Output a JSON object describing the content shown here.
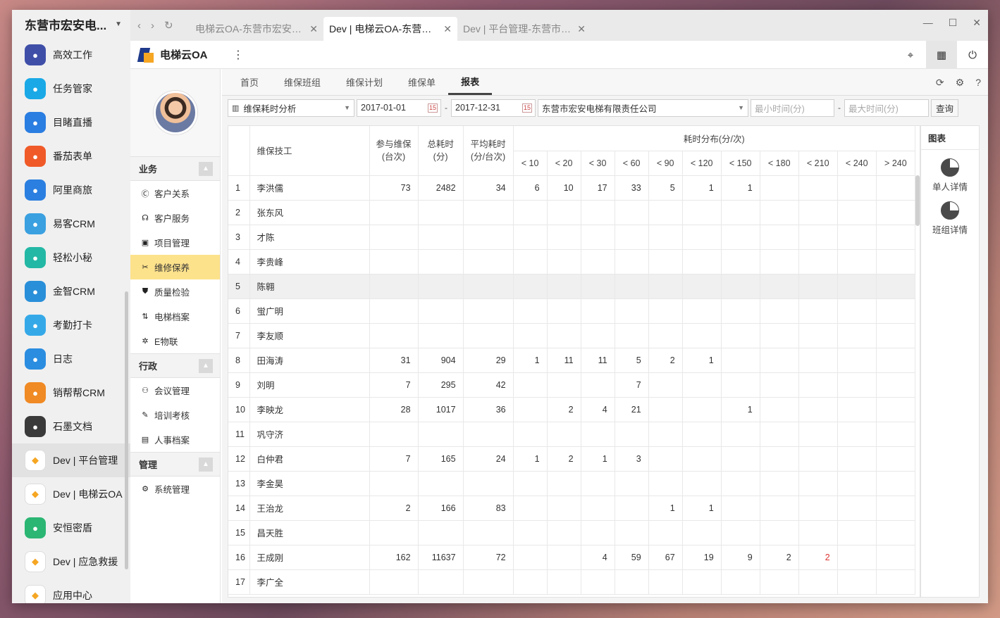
{
  "dock": {
    "title": "东营市宏安电...",
    "items": [
      {
        "label": "高效工作",
        "icon": "star-badge-icon",
        "color": "#3f4fa8"
      },
      {
        "label": "任务管家",
        "icon": "task-icon",
        "color": "#1aa9e6"
      },
      {
        "label": "目睹直播",
        "icon": "play-icon",
        "color": "#2a7de1"
      },
      {
        "label": "番茄表单",
        "icon": "tomato-icon",
        "color": "#f05a28"
      },
      {
        "label": "阿里商旅",
        "icon": "travel-icon",
        "color": "#2b7fe0"
      },
      {
        "label": "易客CRM",
        "icon": "crm-icon",
        "color": "#3aa0e0"
      },
      {
        "label": "轻松小秘",
        "icon": "note-icon",
        "color": "#23b8a5"
      },
      {
        "label": "金智CRM",
        "icon": "chart-icon",
        "color": "#2a8fd9"
      },
      {
        "label": "考勤打卡",
        "icon": "location-icon",
        "color": "#35a9e8"
      },
      {
        "label": "日志",
        "icon": "log-icon",
        "color": "#2b8de0"
      },
      {
        "label": "销帮帮CRM",
        "icon": "b-icon",
        "color": "#f08a24"
      },
      {
        "label": "石墨文档",
        "icon": "shimo-icon",
        "color": "#3a3a3a",
        "selected": true
      },
      {
        "label": "Dev | 平台管理",
        "icon": "platform-logo-icon",
        "color": "#ffffff",
        "selected": true
      },
      {
        "label": "Dev | 电梯云OA",
        "icon": "elevator-logo-icon",
        "color": "#ffffff"
      },
      {
        "label": "安恒密盾",
        "icon": "lock-icon",
        "color": "#2bb673"
      },
      {
        "label": "Dev | 应急救援",
        "icon": "24-icon",
        "color": "#ffffff"
      },
      {
        "label": "应用中心",
        "icon": "app-center-icon",
        "color": "#ffffff"
      }
    ]
  },
  "browser": {
    "tabs": [
      {
        "label": "电梯云OA-东营市宏安电...",
        "active": false
      },
      {
        "label": "Dev | 电梯云OA-东营市...",
        "active": true
      },
      {
        "label": "Dev | 平台管理-东营市宏...",
        "active": false
      }
    ]
  },
  "app": {
    "name": "电梯云OA"
  },
  "sidenav": {
    "sections": [
      {
        "title": "业务",
        "items": [
          {
            "label": "客户关系",
            "icon": "crm-icon"
          },
          {
            "label": "客户服务",
            "icon": "headset-icon"
          },
          {
            "label": "项目管理",
            "icon": "project-icon"
          },
          {
            "label": "维修保养",
            "icon": "tools-icon",
            "active": true
          },
          {
            "label": "质量检验",
            "icon": "shield-icon"
          },
          {
            "label": "电梯档案",
            "icon": "elevator-icon"
          },
          {
            "label": "E物联",
            "icon": "iot-icon"
          }
        ]
      },
      {
        "title": "行政",
        "items": [
          {
            "label": "会议管理",
            "icon": "meeting-icon"
          },
          {
            "label": "培训考核",
            "icon": "training-icon"
          },
          {
            "label": "人事档案",
            "icon": "hr-icon"
          }
        ]
      },
      {
        "title": "管理",
        "items": [
          {
            "label": "系统管理",
            "icon": "gears-icon"
          }
        ]
      }
    ]
  },
  "content_tabs": [
    "首页",
    "维保班组",
    "维保计划",
    "维保单",
    "报表"
  ],
  "filter": {
    "report_type": "维保耗时分析",
    "date_from": "2017-01-01",
    "date_to": "2017-12-31",
    "company": "东营市宏安电梯有限责任公司",
    "min_placeholder": "最小时间(分)",
    "max_placeholder": "最大时间(分)",
    "query_label": "查询"
  },
  "table": {
    "headers": {
      "tech": "维保技工",
      "count": "参与维保\n(台次)",
      "total": "总耗时\n(分)",
      "avg": "平均耗时\n(分/台次)",
      "dist": "耗时分布(分/次)"
    },
    "buckets": [
      "< 10",
      "< 20",
      "< 30",
      "< 60",
      "< 90",
      "< 120",
      "< 150",
      "< 180",
      "< 210",
      "< 240",
      "> 240"
    ],
    "rows": [
      {
        "idx": "1",
        "name": "李洪儒",
        "count": "73",
        "total": "2482",
        "avg": "34",
        "d": [
          "6",
          "10",
          "17",
          "33",
          "5",
          "1",
          "1",
          "",
          "",
          "",
          ""
        ]
      },
      {
        "idx": "2",
        "name": "张东风",
        "count": "",
        "total": "",
        "avg": "",
        "d": [
          "",
          "",
          "",
          "",
          "",
          "",
          "",
          "",
          "",
          "",
          ""
        ]
      },
      {
        "idx": "3",
        "name": "才陈",
        "count": "",
        "total": "",
        "avg": "",
        "d": [
          "",
          "",
          "",
          "",
          "",
          "",
          "",
          "",
          "",
          "",
          ""
        ]
      },
      {
        "idx": "4",
        "name": "李贵峰",
        "count": "",
        "total": "",
        "avg": "",
        "d": [
          "",
          "",
          "",
          "",
          "",
          "",
          "",
          "",
          "",
          "",
          ""
        ]
      },
      {
        "idx": "5",
        "name": "陈翱",
        "count": "",
        "total": "",
        "avg": "",
        "d": [
          "",
          "",
          "",
          "",
          "",
          "",
          "",
          "",
          "",
          "",
          ""
        ],
        "hl": true
      },
      {
        "idx": "6",
        "name": "蛍广明",
        "count": "",
        "total": "",
        "avg": "",
        "d": [
          "",
          "",
          "",
          "",
          "",
          "",
          "",
          "",
          "",
          "",
          ""
        ]
      },
      {
        "idx": "7",
        "name": "李友顺",
        "count": "",
        "total": "",
        "avg": "",
        "d": [
          "",
          "",
          "",
          "",
          "",
          "",
          "",
          "",
          "",
          "",
          ""
        ]
      },
      {
        "idx": "8",
        "name": "田海涛",
        "count": "31",
        "total": "904",
        "avg": "29",
        "d": [
          "1",
          "11",
          "11",
          "5",
          "2",
          "1",
          "",
          "",
          "",
          "",
          ""
        ]
      },
      {
        "idx": "9",
        "name": "刘明",
        "count": "7",
        "total": "295",
        "avg": "42",
        "d": [
          "",
          "",
          "",
          "7",
          "",
          "",
          "",
          "",
          "",
          "",
          ""
        ]
      },
      {
        "idx": "10",
        "name": "李映龙",
        "count": "28",
        "total": "1017",
        "avg": "36",
        "d": [
          "",
          "2",
          "4",
          "21",
          "",
          "",
          "1",
          "",
          "",
          "",
          ""
        ]
      },
      {
        "idx": "11",
        "name": "巩守济",
        "count": "",
        "total": "",
        "avg": "",
        "d": [
          "",
          "",
          "",
          "",
          "",
          "",
          "",
          "",
          "",
          "",
          ""
        ]
      },
      {
        "idx": "12",
        "name": "白仲君",
        "count": "7",
        "total": "165",
        "avg": "24",
        "d": [
          "1",
          "2",
          "1",
          "3",
          "",
          "",
          "",
          "",
          "",
          "",
          ""
        ]
      },
      {
        "idx": "13",
        "name": "李金昊",
        "count": "",
        "total": "",
        "avg": "",
        "d": [
          "",
          "",
          "",
          "",
          "",
          "",
          "",
          "",
          "",
          "",
          ""
        ]
      },
      {
        "idx": "14",
        "name": "王治龙",
        "count": "2",
        "total": "166",
        "avg": "83",
        "d": [
          "",
          "",
          "",
          "",
          "1",
          "1",
          "",
          "",
          "",
          "",
          ""
        ]
      },
      {
        "idx": "15",
        "name": "昌天胜",
        "count": "",
        "total": "",
        "avg": "",
        "d": [
          "",
          "",
          "",
          "",
          "",
          "",
          "",
          "",
          "",
          "",
          ""
        ]
      },
      {
        "idx": "16",
        "name": "王成刚",
        "count": "162",
        "total": "11637",
        "avg": "72",
        "d": [
          "",
          "",
          "4",
          "59",
          "67",
          "19",
          "9",
          "2",
          "2",
          "",
          ""
        ],
        "red": [
          8
        ]
      },
      {
        "idx": "17",
        "name": "李广全",
        "count": "",
        "total": "",
        "avg": "",
        "d": [
          "",
          "",
          "",
          "",
          "",
          "",
          "",
          "",
          "",
          "",
          ""
        ]
      }
    ]
  },
  "chart_panel": {
    "title": "图表",
    "items": [
      "单人详情",
      "班组详情"
    ]
  }
}
